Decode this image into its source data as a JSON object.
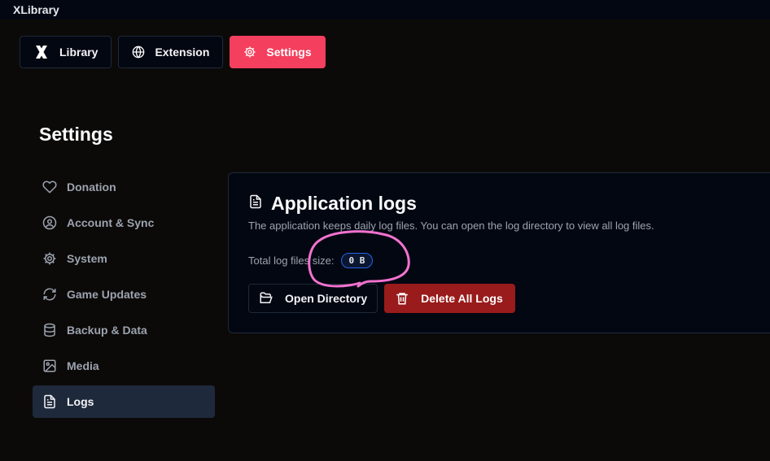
{
  "app": {
    "title": "XLibrary"
  },
  "nav": {
    "tabs": [
      {
        "label": "Library",
        "icon": "x-logo-icon"
      },
      {
        "label": "Extension",
        "icon": "globe-icon"
      },
      {
        "label": "Settings",
        "icon": "gear-icon",
        "active": true
      }
    ]
  },
  "settings": {
    "title": "Settings",
    "sidebar": [
      {
        "label": "Donation",
        "icon": "heart-icon"
      },
      {
        "label": "Account & Sync",
        "icon": "user-circle-icon"
      },
      {
        "label": "System",
        "icon": "gear-icon"
      },
      {
        "label": "Game Updates",
        "icon": "refresh-icon"
      },
      {
        "label": "Backup & Data",
        "icon": "database-icon"
      },
      {
        "label": "Media",
        "icon": "image-icon"
      },
      {
        "label": "Logs",
        "icon": "file-text-icon",
        "active": true
      }
    ]
  },
  "logs": {
    "title": "Application logs",
    "description": "The application keeps daily log files. You can open the log directory to view all log files.",
    "size_label": "Total log files size:",
    "size_value": "0 B",
    "open_button": "Open Directory",
    "delete_button": "Delete All Logs"
  },
  "colors": {
    "accent": "#f43f5e",
    "danger": "#991b1b",
    "active_sidebar": "#1e293b",
    "annotation": "#f472d0"
  }
}
